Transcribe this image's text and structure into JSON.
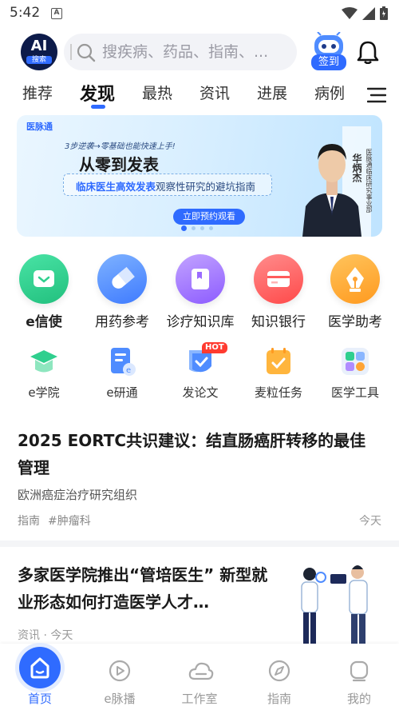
{
  "status_bar": {
    "time": "5:42",
    "notification_icon": "A"
  },
  "header": {
    "logo_main": "AI",
    "logo_sub": "搜索",
    "search_placeholder": "搜疾病、药品、指南、...",
    "signin_label": "签到"
  },
  "tabs": [
    "推荐",
    "发现",
    "最热",
    "资讯",
    "进展",
    "病例"
  ],
  "active_tab": "发现",
  "banner": {
    "brand": "医脉通",
    "steps": "3步逆袭→零基础也能快速上手!",
    "title": "从零到发表",
    "subtitle_highlight": "临床医生高效发表",
    "subtitle_rest": "观察性研究的避坑指南",
    "cta": "立即预约观看",
    "speaker_name": "华炳杰",
    "speaker_org": "医脉通临床研究事业部",
    "slide_count": 4,
    "active_slide": 1
  },
  "main_features": [
    {
      "label": "e信使",
      "icon": "chat-icon",
      "color": "#2fcf8e"
    },
    {
      "label": "用药参考",
      "icon": "pill-icon",
      "color": "#4f8cff"
    },
    {
      "label": "诊疗知识库",
      "icon": "book-icon",
      "color": "#9b6bff"
    },
    {
      "label": "知识银行",
      "icon": "card-icon",
      "color": "#ff5b5b"
    },
    {
      "label": "医学助考",
      "icon": "pen-icon",
      "color": "#ffa436"
    }
  ],
  "sub_features": [
    {
      "label": "e学院",
      "icon": "graduation-cap-icon"
    },
    {
      "label": "e研通",
      "icon": "document-icon"
    },
    {
      "label": "发论文",
      "icon": "shield-check-icon",
      "badge": "HOT"
    },
    {
      "label": "麦粒任务",
      "icon": "task-check-icon"
    },
    {
      "label": "医学工具",
      "icon": "tools-icon"
    }
  ],
  "articles": [
    {
      "title": "2025 EORTC共识建议：结直肠癌肝转移的最佳管理",
      "source": "欧洲癌症治疗研究组织",
      "tags": [
        "指南",
        "#肿瘤科"
      ],
      "time": "今天"
    },
    {
      "title": "多家医学院推出“管培医生” 新型就业形态如何打造医学人才…",
      "meta": "资讯 · 今天"
    }
  ],
  "bottom_nav": [
    {
      "label": "首页",
      "icon": "home-icon",
      "active": true
    },
    {
      "label": "e脉播",
      "icon": "play-icon",
      "active": false
    },
    {
      "label": "工作室",
      "icon": "cloud-icon",
      "active": false
    },
    {
      "label": "指南",
      "icon": "compass-icon",
      "active": false
    },
    {
      "label": "我的",
      "icon": "profile-icon",
      "active": false
    }
  ]
}
